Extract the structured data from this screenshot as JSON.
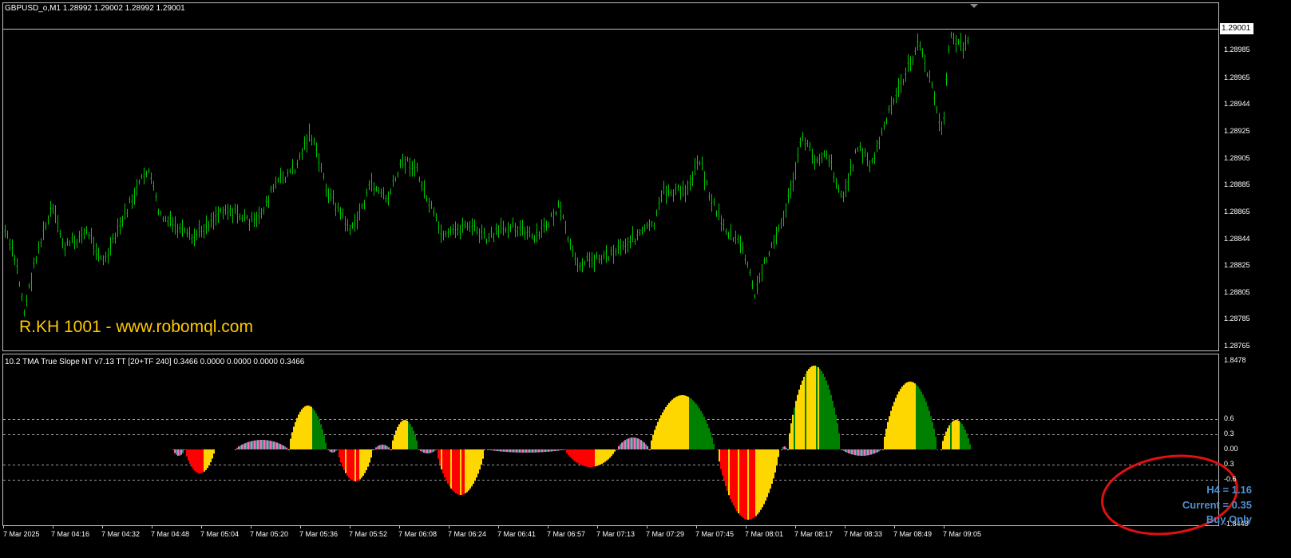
{
  "main_chart": {
    "title": "GBPUSD_o,M1  1.28992 1.29002 1.28992 1.29001",
    "current_price": "1.29001",
    "price_axis": [
      "1.28985",
      "1.28965",
      "1.28944",
      "1.28925",
      "1.28905",
      "1.28885",
      "1.28865",
      "1.28844",
      "1.28825",
      "1.28805",
      "1.28785",
      "1.28765"
    ],
    "watermark": "R.KH 1001 - www.robomql.com",
    "candle_color": "#00C800"
  },
  "indicator": {
    "title": "10.2 TMA True Slope NT v7.13 TT [20+TF 240] 0.3466 0.0000 0.0000 0.0000 0.3466",
    "axis": [
      "1.8478",
      "0.6",
      "0.3",
      "0.00",
      "0.3",
      "-0.6",
      "-1.8448"
    ],
    "colors": {
      "yellow": "#FFD700",
      "green": "#008000",
      "red": "#FF0000",
      "pink": "#FF6EB4",
      "teal": "#3C8C8C"
    },
    "info": {
      "line1": "H4 = 1.16",
      "line2": "Current = 0.35",
      "line3": "Buy Only"
    }
  },
  "time_axis": [
    "7 Mar 2025",
    "7 Mar 04:16",
    "7 Mar 04:32",
    "7 Mar 04:48",
    "7 Mar 05:04",
    "7 Mar 05:20",
    "7 Mar 05:36",
    "7 Mar 05:52",
    "7 Mar 06:08",
    "7 Mar 06:24",
    "7 Mar 06:41",
    "7 Mar 06:57",
    "7 Mar 07:13",
    "7 Mar 07:29",
    "7 Mar 07:45",
    "7 Mar 08:01",
    "7 Mar 08:17",
    "7 Mar 08:33",
    "7 Mar 08:49",
    "7 Mar 09:05"
  ],
  "annotation": {
    "color": "#E01010"
  }
}
